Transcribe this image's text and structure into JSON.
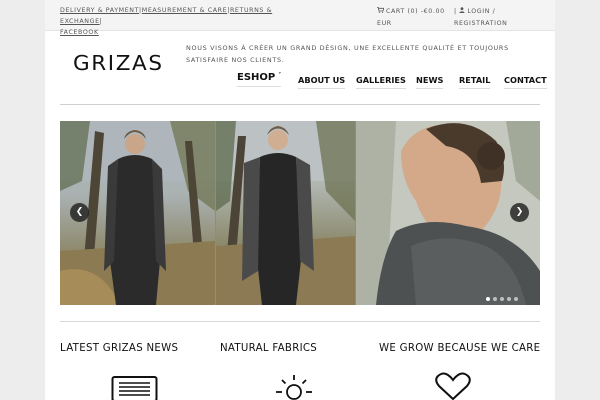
{
  "topbar": {
    "links": [
      "DELIVERY & PAYMENT",
      "MEASUREMENT & CARE",
      "RETURNS & EXCHANGE",
      "FACEBOOK"
    ],
    "cart": "CART (0) -€0.00 EUR",
    "cart_icon": "cart-icon",
    "login": "LOGIN / REGISTRATION",
    "login_icon": "user-icon"
  },
  "header": {
    "logo": "GRIZAS",
    "tagline": "NOUS VISONS À CRÉER UN GRAND DÉSIGN, UNE EXCELLENTE QUALITÉ ET TOUJOURS SATISFAIRE NOS CLIENTS."
  },
  "nav": {
    "items": [
      "ESHOP",
      "ABOUT US",
      "GALLERIES",
      "NEWS",
      "RETAIL",
      "CONTACT"
    ]
  },
  "slider": {
    "prev_icon": "chevron-left-icon",
    "next_icon": "chevron-right-icon",
    "slide_count": 5,
    "active_slide": 1
  },
  "features": [
    {
      "title": "LATEST GRIZAS NEWS",
      "icon": "newspaper-icon"
    },
    {
      "title": "NATURAL FABRICS",
      "icon": "sun-icon"
    },
    {
      "title": "WE GROW BECAUSE WE CARE",
      "icon": "heart-icon"
    }
  ],
  "colors": {
    "background": "#ededed",
    "page": "#ffffff",
    "text": "#111111",
    "arrow_bg": "#1e1e1e"
  }
}
